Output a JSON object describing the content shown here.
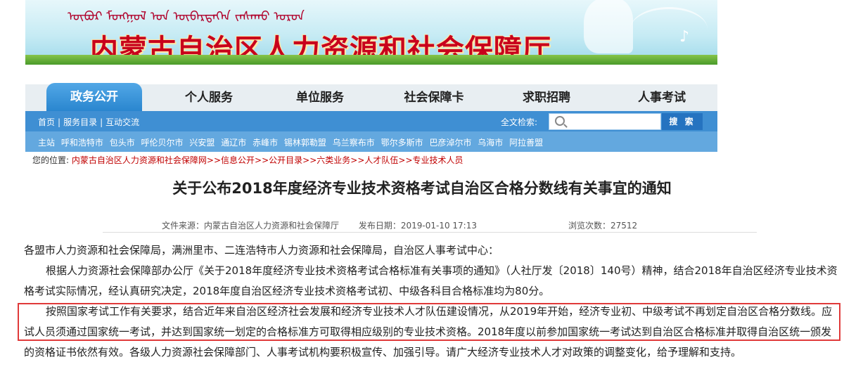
{
  "banner": {
    "mongolian_text": "ᠥᠪᠦᠷ ᠮᠣᠩᠭᠣᠯ ᠤᠨ ᠥᠪᠡᠷᠲᠡᠭᠡᠨ ᠵᠠᠰᠠᠬᠤ ᠣᠷᠣᠨ",
    "title": "内蒙古自治区人力资源和社会保障厅"
  },
  "nav": {
    "tabs": [
      {
        "label": "政务公开",
        "active": true
      },
      {
        "label": "个人服务",
        "active": false
      },
      {
        "label": "单位服务",
        "active": false
      },
      {
        "label": "社会保障卡",
        "active": false
      },
      {
        "label": "求职招聘",
        "active": false
      },
      {
        "label": "人事考试",
        "active": false
      }
    ]
  },
  "subbar": {
    "links": [
      "首页",
      "服务目录",
      "互动交流"
    ],
    "search_label": "全文检索:",
    "search_placeholder": "",
    "search_button": "搜 索"
  },
  "cities": [
    "主站",
    "呼和浩特市",
    "包头市",
    "呼伦贝尔市",
    "兴安盟",
    "通辽市",
    "赤峰市",
    "锡林郭勒盟",
    "乌兰察布市",
    "鄂尔多斯市",
    "巴彦淖尔市",
    "乌海市",
    "阿拉善盟"
  ],
  "breadcrumb": {
    "prefix": "您的位置:",
    "items": [
      "内蒙古自治区人力资源和社会保障网",
      "信息公开",
      "公开目录",
      "六类业务",
      "人才队伍",
      "专业技术人员"
    ]
  },
  "article": {
    "title": "关于公布2018年度经济专业技术资格考试自治区合格分数线有关事宜的通知",
    "source": "文件来源：内蒙古自治区人力资源和社会保障厅",
    "date": "发布日期：2019-01-10 17:13",
    "views": "浏览次数：27512",
    "salutation": "各盟市人力资源和社会保障局，满洲里市、二连浩特市人力资源和社会保障局，自治区人事考试中心：",
    "para1": "根据人力资源社会保障部办公厅《关于2018年度经济专业技术资格考试合格标准有关事项的通知》（人社厅发〔2018〕140号）精神，结合2018年自治区经济专业技术资格考试实际情况，经认真研究决定，2018年度自治区经济专业技术资格考试初、中级各科目合格标准均为80分。",
    "para2": "按照国家考试工作有关要求，结合近年来自治区经济社会发展和经济专业技术人才队伍建设情况，从2019年开始，经济专业初、中级考试不再划定自治区合格分数线。应试人员须通过国家统一考试，并达到国家统一划定的合格标准方可取得相应级别的专业技术资格。2018年度以前参加国家统一考试达到自治区合格标准并取得自治区统一颁发的资格证书依然有效。各级人力资源社会保障部门、人事考试机构要积极宣传、加强引导。请广大经济专业技术人才对政策的调整变化，给予理解和支持。"
  },
  "colors": {
    "nav_active": "#2a86cf",
    "subbar": "#3f8fd3",
    "citybar": "#63a8df",
    "breadcrumb_link": "#c00000",
    "highlight_border": "#e03a3a"
  }
}
